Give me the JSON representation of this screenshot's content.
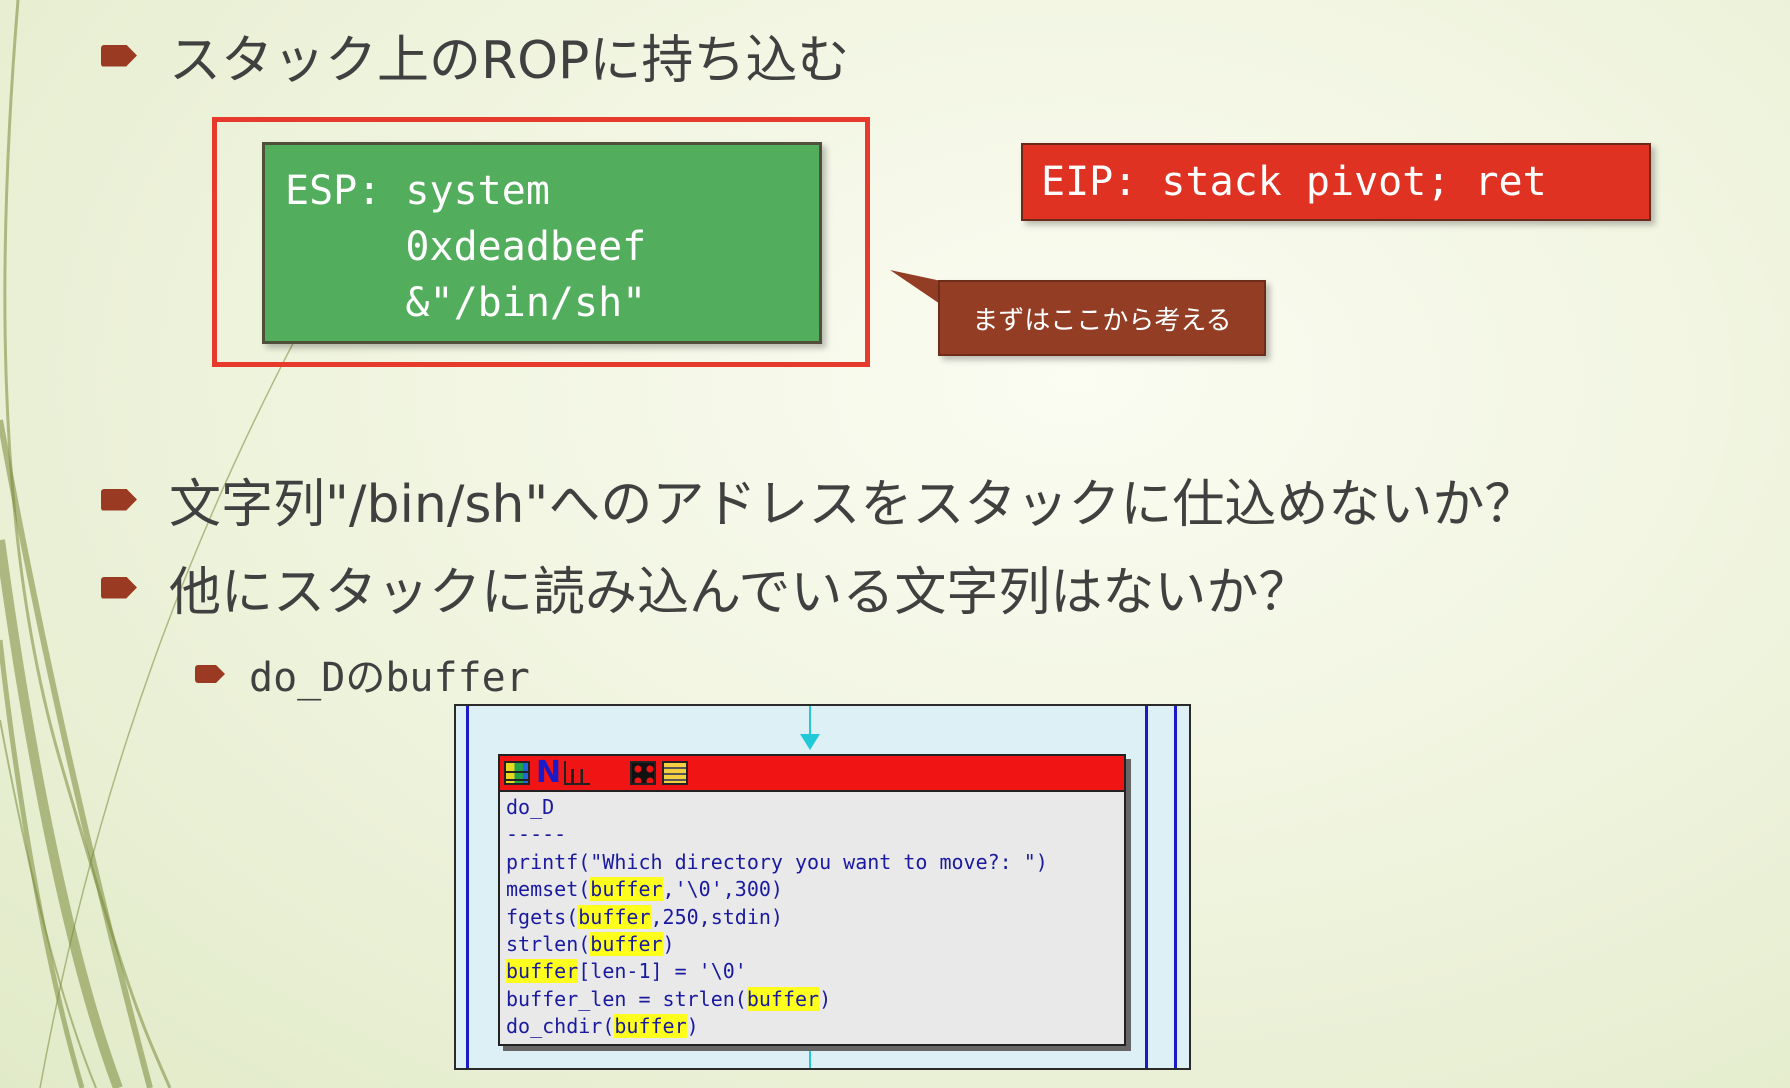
{
  "slide": {
    "bullet1": "スタック上のROPに持ち込む",
    "esp_box": {
      "line1": "ESP: system",
      "line2": "     0xdeadbeef",
      "line3": "     &\"/bin/sh\""
    },
    "eip_box": "EIP: stack pivot; ret",
    "callout": "まずはここから考える",
    "bullet2": "文字列\"/bin/sh\"へのアドレスをスタックに仕込めないか？",
    "bullet3": "他にスタックに読み込んでいる文字列はないか？",
    "subbullet": "do_Dのbuffer"
  },
  "code_node": {
    "lines": [
      [
        {
          "t": "do_D"
        }
      ],
      [
        {
          "t": "-----"
        }
      ],
      [
        {
          "t": "printf(\"Which directory you want to move?: \")"
        }
      ],
      [
        {
          "t": "memset("
        },
        {
          "t": "buffer",
          "h": true
        },
        {
          "t": ",'\\0',300)"
        }
      ],
      [
        {
          "t": "fgets("
        },
        {
          "t": "buffer",
          "h": true
        },
        {
          "t": ",250,stdin)"
        }
      ],
      [
        {
          "t": "strlen("
        },
        {
          "t": "buffer",
          "h": true
        },
        {
          "t": ")"
        }
      ],
      [
        {
          "t": "buffer",
          "h": true
        },
        {
          "t": "[len-1] = '\\0'"
        }
      ],
      [
        {
          "t": "buffer_len = strlen("
        },
        {
          "t": "buffer",
          "h": true
        },
        {
          "t": ")"
        }
      ],
      [
        {
          "t": "do_chdir("
        },
        {
          "t": "buffer",
          "h": true
        },
        {
          "t": ")"
        }
      ]
    ],
    "toolbar_icons": [
      "grid-icon",
      "n-icon",
      "chart-icon",
      "graph-icon",
      "doc-icon"
    ],
    "colors": {
      "titlebar": "#f01414",
      "highlight": "#ffff1e",
      "code": "#1a1aa0"
    }
  },
  "theme": {
    "accent": "#9a3a22",
    "green": "#52ad5c",
    "red": "#df3222",
    "callout": "#933d25"
  }
}
